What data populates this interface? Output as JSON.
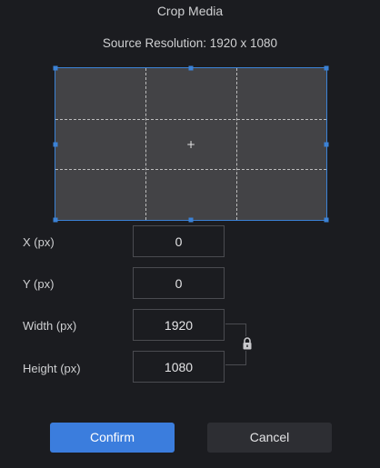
{
  "dialog": {
    "title": "Crop Media",
    "source_resolution": "Source Resolution: 1920 x 1080"
  },
  "crop_preview": {
    "center_marker": "+",
    "accent_color": "#3b82d6",
    "icons": [
      "crosshair-icon"
    ]
  },
  "fields": {
    "x": {
      "label": "X (px)",
      "value": "0"
    },
    "y": {
      "label": "Y (px)",
      "value": "0"
    },
    "width": {
      "label": "Width (px)",
      "value": "1920"
    },
    "height": {
      "label": "Height (px)",
      "value": "1080"
    }
  },
  "aspect_lock": {
    "icon": "lock-icon",
    "locked": true
  },
  "buttons": {
    "confirm_label": "Confirm",
    "cancel_label": "Cancel",
    "confirm_color": "#3b7ddd"
  }
}
